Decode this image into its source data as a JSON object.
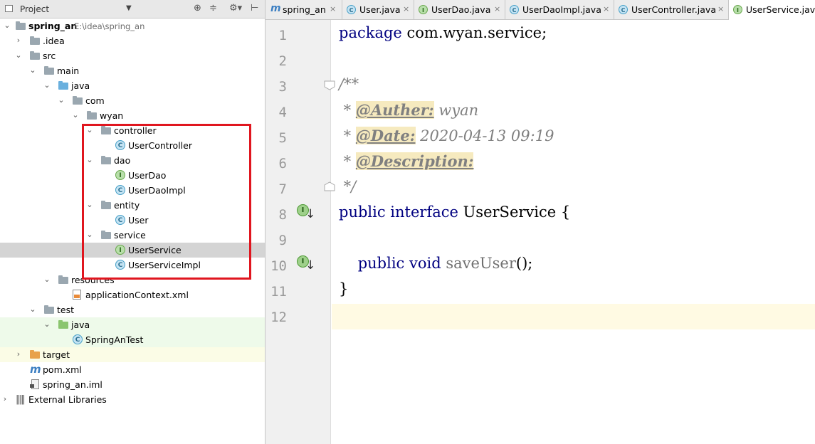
{
  "project_pane": {
    "title": "Project",
    "toolbar_icons": [
      "target-icon",
      "collapse-icon",
      "gear-icon",
      "hide-icon"
    ],
    "tree": [
      {
        "label": "spring_an",
        "path": "E:\\idea\\spring_an",
        "depth": 0,
        "expanded": true,
        "icon": "module-folder-icon"
      },
      {
        "label": ".idea",
        "depth": 1,
        "expanded": false,
        "icon": "folder-icon"
      },
      {
        "label": "src",
        "depth": 1,
        "expanded": true,
        "icon": "folder-icon"
      },
      {
        "label": "main",
        "depth": 2,
        "expanded": true,
        "icon": "folder-icon"
      },
      {
        "label": "java",
        "depth": 3,
        "expanded": true,
        "icon": "source-folder-icon"
      },
      {
        "label": "com",
        "depth": 4,
        "expanded": true,
        "icon": "package-icon"
      },
      {
        "label": "wyan",
        "depth": 5,
        "expanded": true,
        "icon": "package-icon"
      },
      {
        "label": "controller",
        "depth": 6,
        "expanded": true,
        "icon": "package-icon"
      },
      {
        "label": "UserController",
        "depth": 7,
        "icon": "class-icon"
      },
      {
        "label": "dao",
        "depth": 6,
        "expanded": true,
        "icon": "package-icon"
      },
      {
        "label": "UserDao",
        "depth": 7,
        "icon": "interface-icon"
      },
      {
        "label": "UserDaoImpl",
        "depth": 7,
        "icon": "class-icon"
      },
      {
        "label": "entity",
        "depth": 6,
        "expanded": true,
        "icon": "package-icon"
      },
      {
        "label": "User",
        "depth": 7,
        "icon": "class-icon"
      },
      {
        "label": "service",
        "depth": 6,
        "expanded": true,
        "icon": "package-icon"
      },
      {
        "label": "UserService",
        "depth": 7,
        "icon": "interface-icon",
        "selected": true
      },
      {
        "label": "UserServiceImpl",
        "depth": 7,
        "icon": "class-icon"
      },
      {
        "label": "resources",
        "depth": 3,
        "expanded": true,
        "icon": "resources-folder-icon"
      },
      {
        "label": "applicationContext.xml",
        "depth": 4,
        "icon": "xml-file-icon"
      },
      {
        "label": "test",
        "depth": 2,
        "expanded": true,
        "icon": "folder-icon"
      },
      {
        "label": "java",
        "depth": 3,
        "expanded": true,
        "icon": "test-folder-icon"
      },
      {
        "label": "SpringAnTest",
        "depth": 4,
        "icon": "test-class-icon"
      },
      {
        "label": "target",
        "depth": 1,
        "expanded": false,
        "icon": "excluded-folder-icon"
      },
      {
        "label": "pom.xml",
        "depth": 1,
        "icon": "maven-icon"
      },
      {
        "label": "spring_an.iml",
        "depth": 1,
        "icon": "iml-file-icon"
      },
      {
        "label": "External Libraries",
        "depth": 0,
        "expanded": false,
        "icon": "libraries-icon"
      }
    ]
  },
  "editor": {
    "tabs": [
      {
        "label": "spring_an",
        "icon": "maven-icon"
      },
      {
        "label": "User.java",
        "icon": "class-icon"
      },
      {
        "label": "UserDao.java",
        "icon": "interface-icon"
      },
      {
        "label": "UserDaoImpl.java",
        "icon": "class-icon"
      },
      {
        "label": "UserController.java",
        "icon": "class-icon"
      },
      {
        "label": "UserService.java",
        "icon": "interface-icon",
        "active": true
      }
    ],
    "close_glyph": "×",
    "line_numbers": [
      "1",
      "2",
      "3",
      "4",
      "5",
      "6",
      "7",
      "8",
      "9",
      "10",
      "11",
      "12"
    ],
    "code": {
      "l1_kw": "package",
      "l1_rest": " com.wyan.service;",
      "l3": "/**",
      "l4_star": " * ",
      "l4_tag": "@Auther:",
      "l4_val": " wyan",
      "l5_star": " * ",
      "l5_tag": "@Date:",
      "l5_val": " 2020-04-13 09:19",
      "l6_star": " * ",
      "l6_tag": "@Description:",
      "l7": " */",
      "l8_kw1": "public",
      "l8_kw2": "interface",
      "l8_rest": " UserService {",
      "l10_kw1": "public",
      "l10_kw2": "void",
      "l10_fn": "saveUser",
      "l10_rest": "();",
      "l11": "}"
    },
    "gutter_badge": "I",
    "gutter_arrow": "↓"
  },
  "colors": {
    "highlight_box": "#e0161f",
    "keyword": "#000080",
    "comment": "#808080"
  }
}
